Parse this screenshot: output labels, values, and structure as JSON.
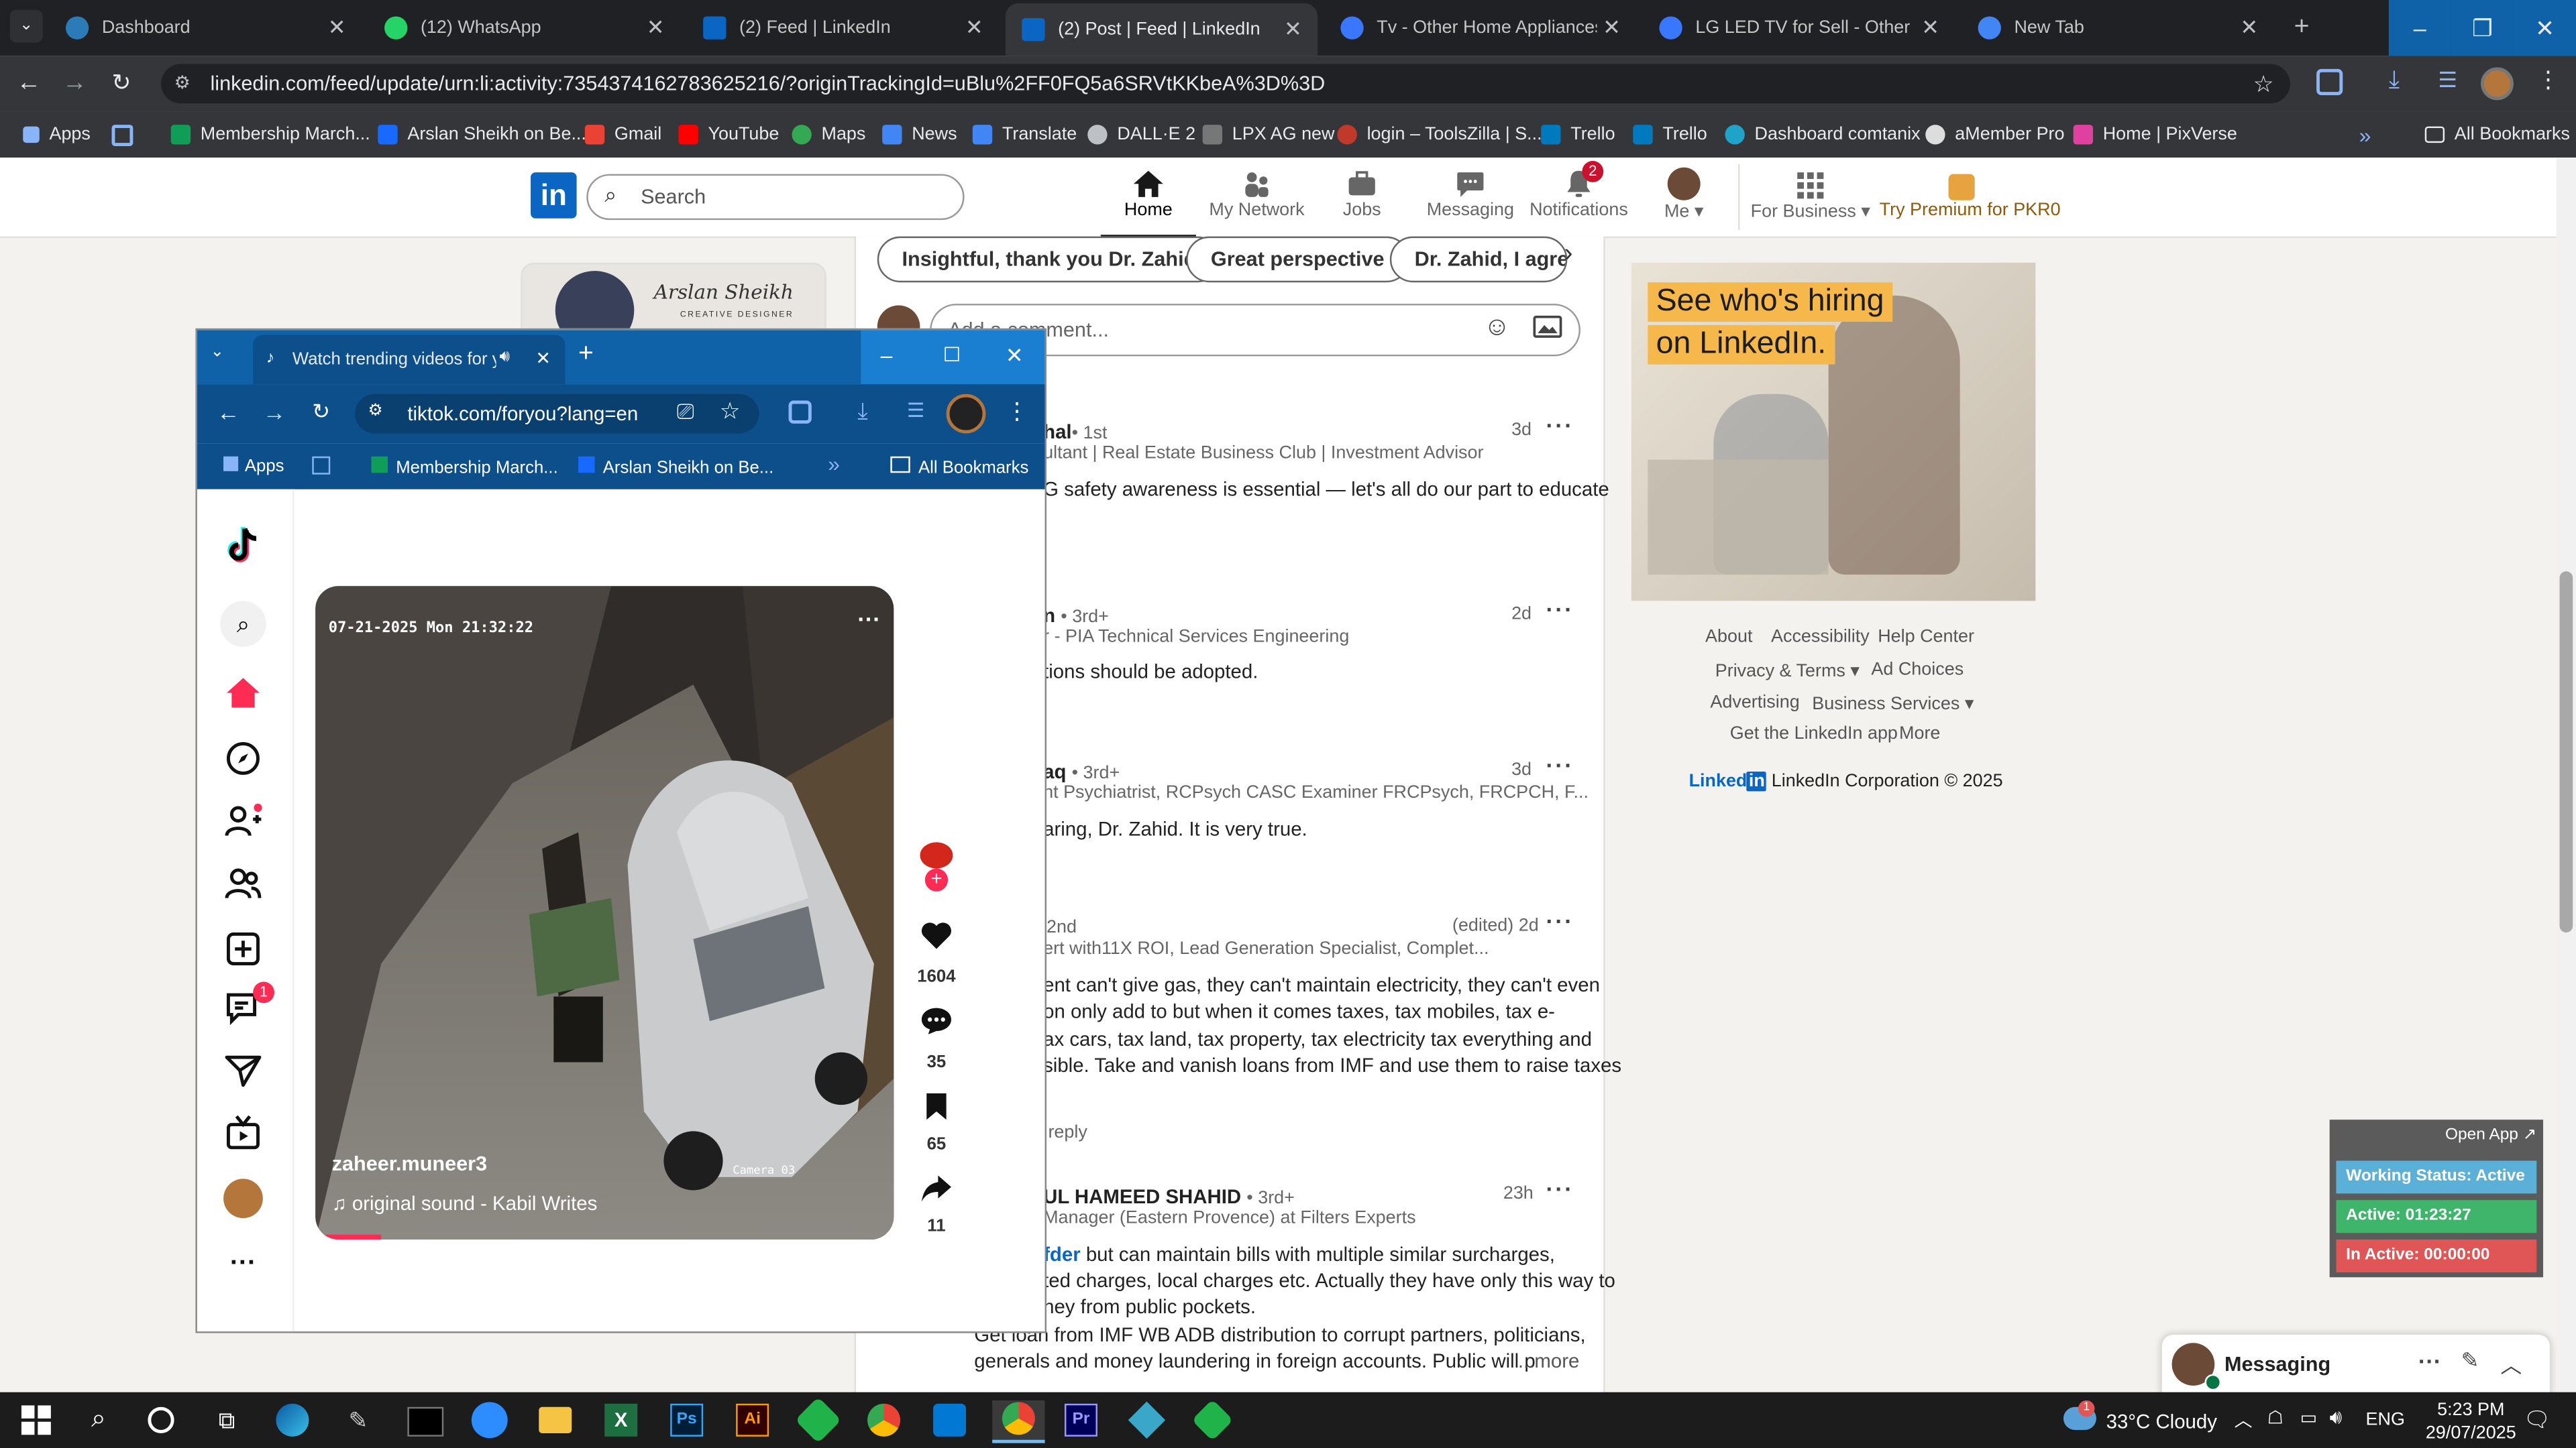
{
  "browser": {
    "tabs": [
      {
        "title": "Dashboard",
        "color": "#2b7bb9"
      },
      {
        "title": "(12) WhatsApp",
        "color": "#25d366"
      },
      {
        "title": "(2) Feed | LinkedIn",
        "color": "#0a66c2"
      },
      {
        "title": "(2) Post | Feed | LinkedIn",
        "color": "#0a66c2"
      },
      {
        "title": "Tv - Other Home Appliances fo",
        "color": "#3a77ff"
      },
      {
        "title": "LG LED TV for Sell - Other Hom",
        "color": "#3a77ff"
      },
      {
        "title": "New Tab",
        "color": "#4285f4"
      }
    ],
    "url": "linkedin.com/feed/update/urn:li:activity:7354374162783625216/?originTrackingId=uBlu%2FF0FQ5a6SRVtKKbeA%3D%3D",
    "bookmarks": [
      "Apps",
      "Membership March...",
      "Arslan Sheikh on Be...",
      "Gmail",
      "YouTube",
      "Maps",
      "News",
      "Translate",
      "DALL·E 2",
      "LPX AG new",
      "login – ToolsZilla | S...",
      "Trello",
      "Trello",
      "Dashboard comtanix",
      "aMember Pro",
      "Home | PixVerse"
    ],
    "all_bookmarks": "All Bookmarks"
  },
  "linkedin": {
    "search_placeholder": "Search",
    "nav": [
      "Home",
      "My Network",
      "Jobs",
      "Messaging",
      "Notifications",
      "Me",
      "For Business",
      "Try Premium for PKR0"
    ],
    "notification_count": "2",
    "profile_name": "Arslan Sheikh",
    "profile_subtitle": "CREATIVE DESIGNER",
    "suggestions": [
      "Insightful, thank you Dr. Zahid",
      "Great perspective",
      "Dr. Zahid, I agree"
    ],
    "comment_placeholder": "Add a comment...",
    "comments": [
      {
        "name": "hal",
        "degree": "• 1st",
        "headline": "ultant | Real Estate Business Club | Investment Advisor",
        "time": "3d",
        "text": [
          "G safety awareness is essential — let's all do our part to educate"
        ]
      },
      {
        "name": "n",
        "degree": "• 3rd+",
        "headline": "r - PIA Technical Services Engineering",
        "time": "2d",
        "text": [
          "tions should be adopted."
        ]
      },
      {
        "name": "aq",
        "degree": "• 3rd+",
        "headline": "nt Psychiatrist, RCPsych CASC Examiner FRCPsych, FRCPCH, F...",
        "time": "3d",
        "text": [
          "aring, Dr. Zahid. It is very true."
        ]
      },
      {
        "name": "",
        "degree": "2nd",
        "headline": "ert with11X ROI, Lead Generation Specialist, Complet...",
        "time": "(edited) 2d",
        "text": [
          "ent can't give gas, they can't maintain electricity, they can't even",
          "on only add to but when it comes taxes, tax mobiles, tax e-",
          "ax cars, tax land, tax property, tax electricity tax everything and",
          "sible. Take and vanish loans from IMF and use them to raise taxes"
        ]
      },
      {
        "name": "UL HAMEED SHAHID",
        "degree": "• 3rd+",
        "headline": "Manager (Eastern Provence) at Filters Experts",
        "time": "23h",
        "text": [
          "but can maintain bills with multiple similar surcharges,",
          "ted charges, local charges etc. Actually they have only this way to",
          "ney from public pockets.",
          "Get loan from IMF WB ADB distribution to corrupt partners, politicians,",
          "generals and money laundering in foreign accounts. Public will p"
        ]
      }
    ],
    "reply": "reply",
    "mention": "fder",
    "more": "...more",
    "ad": {
      "line1": "See who's hiring",
      "line2": "on LinkedIn."
    },
    "footer": [
      "About",
      "Accessibility",
      "Help Center",
      "Privacy & Terms",
      "Ad Choices",
      "Advertising",
      "Business Services",
      "Get the LinkedIn app",
      "More"
    ],
    "corp": "LinkedIn Corporation © 2025",
    "messaging": "Messaging"
  },
  "tracker": {
    "open_app": "Open App ↗",
    "working": "Working Status: Active",
    "active": "Active: 01:23:27",
    "inactive": "In Active: 00:00:00"
  },
  "tiktok_window": {
    "tab_title": "Watch trending videos for y",
    "url": "tiktok.com/foryou?lang=en",
    "bookmarks": [
      "Apps",
      "Membership March...",
      "Arslan Sheikh on Be..."
    ],
    "all_bookmarks": "All Bookmarks",
    "video_timestamp": "07-21-2025 Mon 21:32:22",
    "camera_label": "Camera 03",
    "username": "zaheer.muneer3",
    "sound": "original sound - Kabil Writes",
    "likes": "1604",
    "comments": "35",
    "saves": "65",
    "shares": "11",
    "inbox_badge": "1"
  },
  "taskbar": {
    "weather": "33°C  Cloudy",
    "weather_badge": "1",
    "lang": "ENG",
    "time": "5:23 PM",
    "date": "29/07/2025"
  }
}
